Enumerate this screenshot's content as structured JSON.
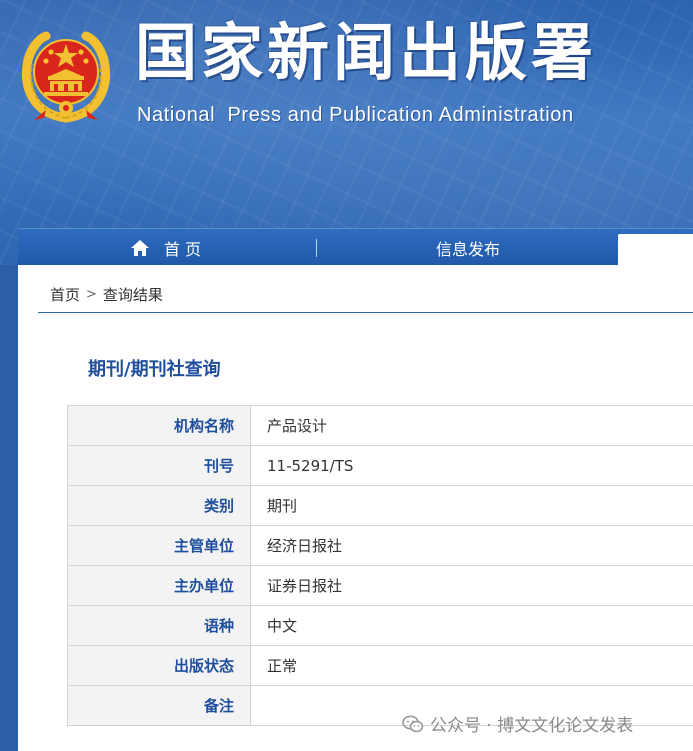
{
  "header": {
    "title_cn": "国家新闻出版署",
    "title_en": "National  Press and Publication Administration"
  },
  "nav": {
    "home_label": "首 页",
    "info_label": "信息发布"
  },
  "breadcrumb": {
    "home": "首页",
    "separator": ">",
    "current": "查询结果"
  },
  "page": {
    "title": "期刊/期刊社查询"
  },
  "result_table": {
    "rows": [
      {
        "label": "机构名称",
        "value": "产品设计"
      },
      {
        "label": "刊号",
        "value": "11-5291/TS"
      },
      {
        "label": "类别",
        "value": "期刊"
      },
      {
        "label": "主管单位",
        "value": "经济日报社"
      },
      {
        "label": "主办单位",
        "value": "证券日报社"
      },
      {
        "label": "语种",
        "value": "中文"
      },
      {
        "label": "出版状态",
        "value": "正常"
      },
      {
        "label": "备注",
        "value": ""
      }
    ]
  },
  "watermark": {
    "text": "公众号 · 搏文文化论文发表"
  },
  "colors": {
    "banner_blue": "#2f66b2",
    "label_blue": "#1f4f9c",
    "emblem_red": "#d9261c",
    "emblem_gold": "#f2c030"
  }
}
